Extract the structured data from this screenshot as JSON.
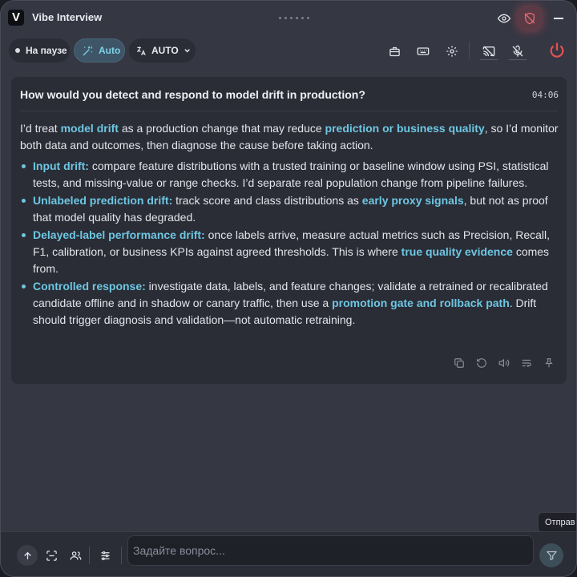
{
  "app": {
    "logo_letter": "V",
    "title": "Vibe Interview"
  },
  "toolbar": {
    "pause_label": "На паузе",
    "auto_label": "Auto",
    "language_label": "AUTO"
  },
  "question": {
    "text": "How would you detect and respond to model drift in production?",
    "time": "04:06"
  },
  "answer": {
    "intro": [
      "I’d treat ",
      "model drift",
      " as a production change that may reduce ",
      "prediction or business quality",
      ", so I’d monitor both data and outcomes, then diagnose the cause before taking action."
    ],
    "bullets": [
      {
        "term": "Input drift:",
        "parts": [
          " compare feature distributions with a trusted training or baseline window using PSI, statistical tests, and missing-value or range checks. I’d separate real population change from pipeline failures."
        ]
      },
      {
        "term": "Unlabeled prediction drift:",
        "parts": [
          " track score and class distributions as ",
          "early proxy signals",
          ", but not as proof that model quality has degraded."
        ]
      },
      {
        "term": "Delayed-label performance drift:",
        "parts": [
          " once labels arrive, measure actual metrics such as Precision, Recall, F1, calibration, or business KPIs against agreed thresholds. This is where ",
          "true quality evidence",
          " comes from."
        ]
      },
      {
        "term": "Controlled response:",
        "parts": [
          " investigate data, labels, and feature changes; validate a retrained or recalibrated candidate offline and in shadow or canary traffic, then use a ",
          "promotion gate and rollback path",
          ". Drift should trigger diagnosis and validation—not automatic retraining."
        ]
      }
    ]
  },
  "tooltip": {
    "text": "Отправ"
  },
  "input": {
    "placeholder": "Задайте вопрос..."
  },
  "colors": {
    "accent": "#6dc7e2",
    "power": "#e0534f",
    "background": "#353743",
    "card": "#2a2c36"
  },
  "icons": [
    "eye-icon",
    "shield-off-icon",
    "minimize-icon",
    "magic-wand-icon",
    "translate-icon",
    "chevron-down-icon",
    "briefcase-icon",
    "keyboard-icon",
    "gear-icon",
    "cast-off-icon",
    "mic-off-icon",
    "power-icon",
    "copy-icon",
    "refresh-icon",
    "speaker-icon",
    "wrap-icon",
    "pin-icon",
    "arrow-up-icon",
    "scan-icon",
    "users-icon",
    "sliders-icon",
    "send-icon"
  ]
}
